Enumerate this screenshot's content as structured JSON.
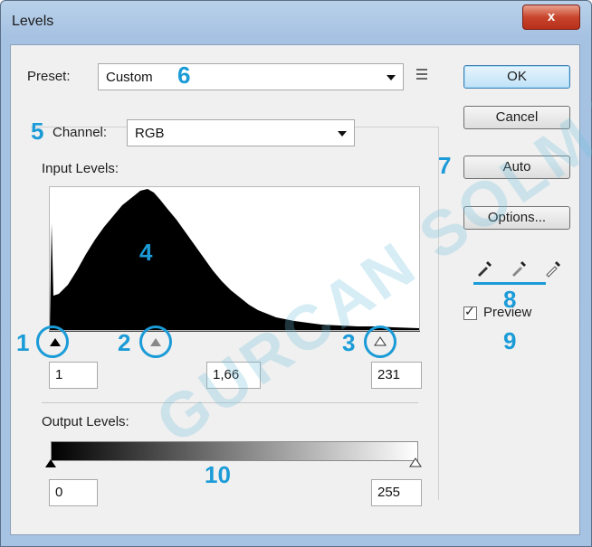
{
  "window": {
    "title": "Levels",
    "close_glyph": "x"
  },
  "preset": {
    "label": "Preset:",
    "value": "Custom",
    "menu_icon": "list-menu-icon"
  },
  "channel": {
    "label": "Channel:",
    "value": "RGB"
  },
  "input_levels": {
    "label": "Input Levels:",
    "black": "1",
    "gamma": "1,66",
    "white": "231"
  },
  "output_levels": {
    "label": "Output Levels:",
    "black": "0",
    "white": "255"
  },
  "buttons": {
    "ok": "OK",
    "cancel": "Cancel",
    "auto": "Auto",
    "options": "Options..."
  },
  "eyedroppers": [
    "black-eyedropper-icon",
    "gray-eyedropper-icon",
    "white-eyedropper-icon"
  ],
  "preview": {
    "label": "Preview",
    "checked": true
  },
  "callouts": {
    "n1": "1",
    "n2": "2",
    "n3": "3",
    "n4": "4",
    "n5": "5",
    "n6": "6",
    "n7": "7",
    "n8": "8",
    "n9": "9",
    "n10": "10"
  },
  "watermark": "GURCAN SOLMAZ",
  "colors": {
    "accent": "#1b9bd7",
    "title_bar": "#b9d1ea",
    "close": "#c8452c"
  }
}
